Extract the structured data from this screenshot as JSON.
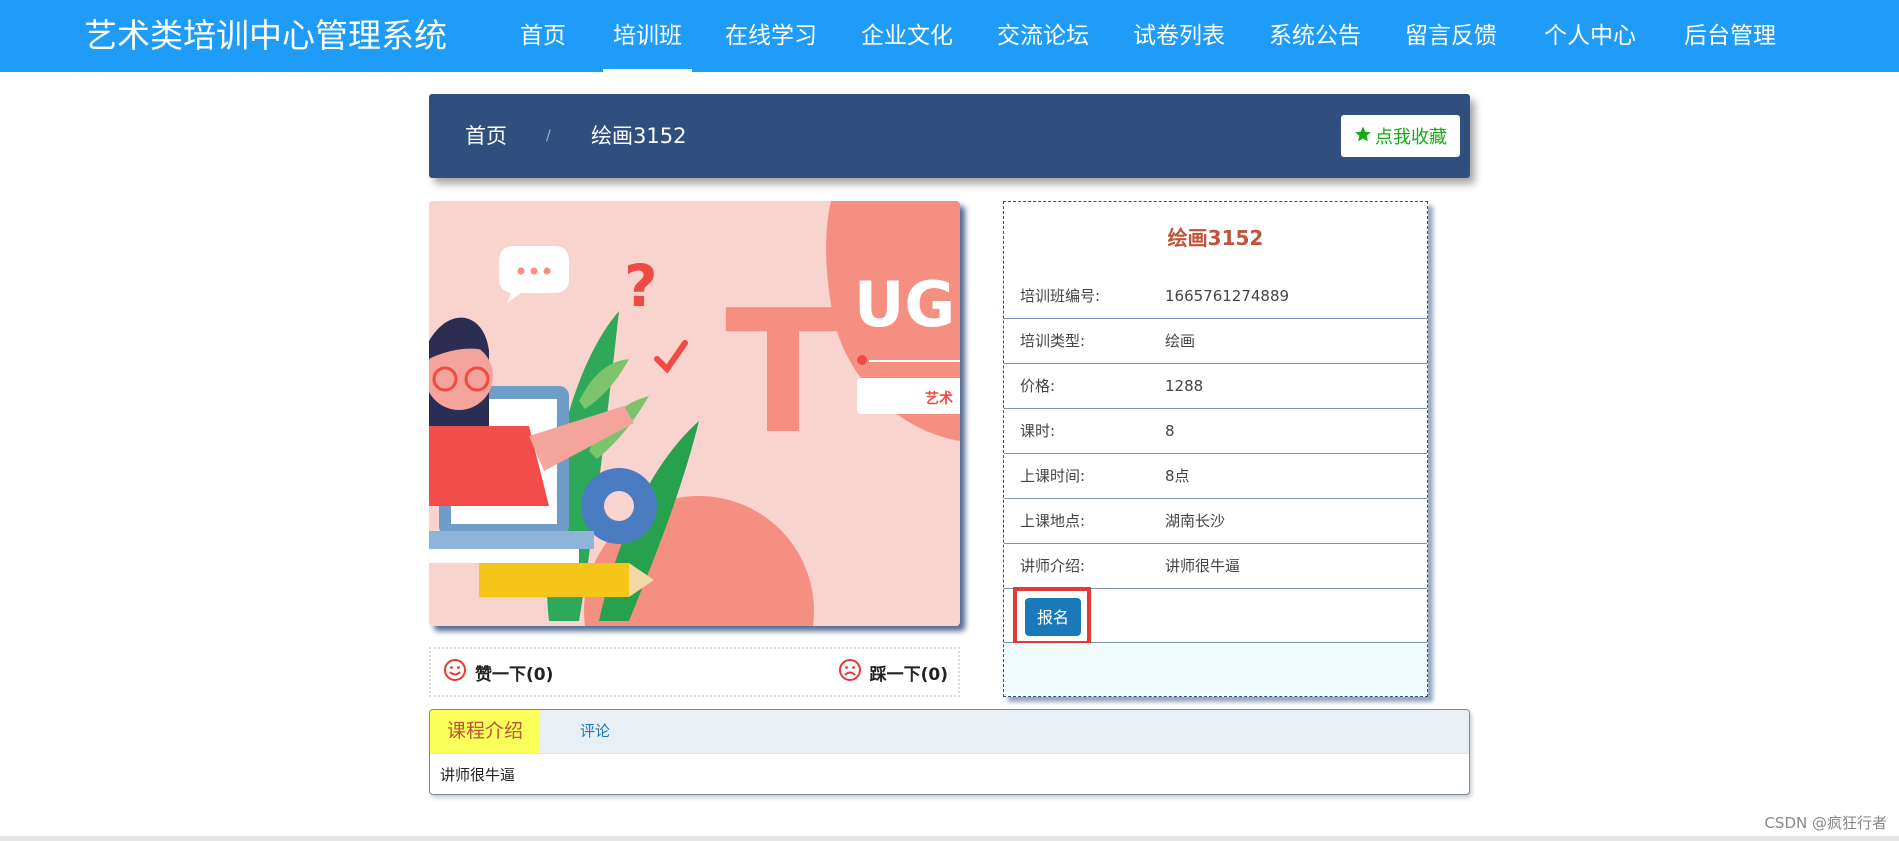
{
  "nav": {
    "brand": "艺术类培训中心管理系统",
    "items": [
      "首页",
      "培训班",
      "在线学习",
      "企业文化",
      "交流论坛",
      "试卷列表",
      "系统公告",
      "留言反馈",
      "个人中心",
      "后台管理"
    ],
    "active_index": 1
  },
  "breadcrumb": {
    "home": "首页",
    "separator": "/",
    "current": "绘画3152",
    "favorite_label": "点我收藏"
  },
  "banner": {
    "big_letter": "T",
    "text_right": "UG",
    "badge_text": "艺术"
  },
  "votes": {
    "like": "赞一下(0)",
    "dislike": "踩一下(0)"
  },
  "detail": {
    "title": "绘画3152",
    "rows": [
      {
        "label": "培训班编号:",
        "value": "1665761274889"
      },
      {
        "label": "培训类型:",
        "value": "绘画"
      },
      {
        "label": "价格:",
        "value": "1288"
      },
      {
        "label": "课时:",
        "value": "8"
      },
      {
        "label": "上课时间:",
        "value": "8点"
      },
      {
        "label": "上课地点:",
        "value": "湖南长沙"
      },
      {
        "label": "讲师介绍:",
        "value": "讲师很牛逼"
      }
    ],
    "signup_label": "报名"
  },
  "tabs": {
    "items": [
      "课程介绍",
      "评论"
    ],
    "content": "讲师很牛逼"
  },
  "watermark": "CSDN @疯狂行者",
  "colors": {
    "nav_bg": "#1e9cf7",
    "crumb_bg": "#2f4f7f",
    "favorite_green": "#18a818",
    "title_red": "#c0533a",
    "signup_blue": "#1a7ab9",
    "highlight_red": "#e53935",
    "tab_active_bg": "#faff5a"
  }
}
